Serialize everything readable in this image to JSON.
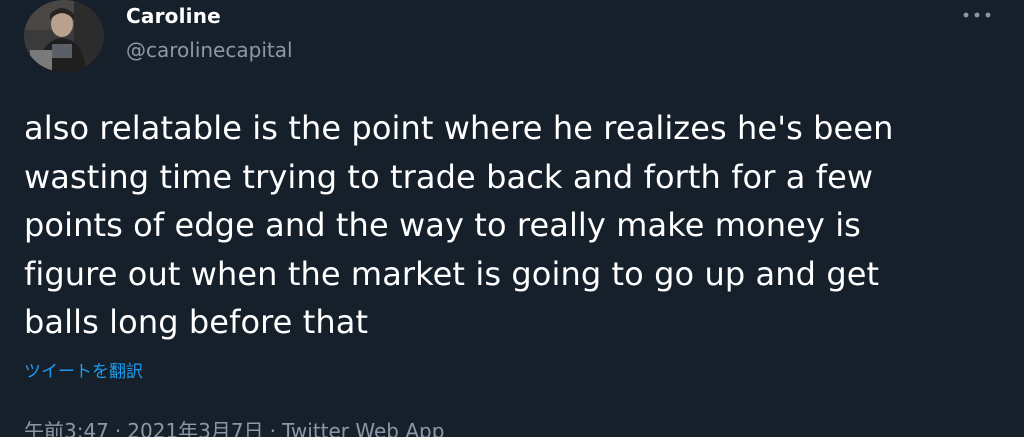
{
  "author": {
    "display_name": "Caroline",
    "handle": "@carolinecapital",
    "avatar_icon": "user-avatar-photo"
  },
  "more_icon": "more-horizontal-icon",
  "tweet": {
    "text": "also relatable is the point where he realizes he's been\nwasting time trying to trade back and forth for a few\npoints of edge and the way to really make money is\nfigure out when the market is going to go up and get\nballs long before that",
    "translate_label": "ツイートを翻訳"
  },
  "meta": {
    "time": "午前3:47",
    "separator": "·",
    "date": "2021年3月7日",
    "source": "Twitter Web App"
  },
  "colors": {
    "background": "#15202b",
    "text_primary": "#ffffff",
    "text_secondary": "#8b98a5",
    "link": "#1d9bf0"
  }
}
